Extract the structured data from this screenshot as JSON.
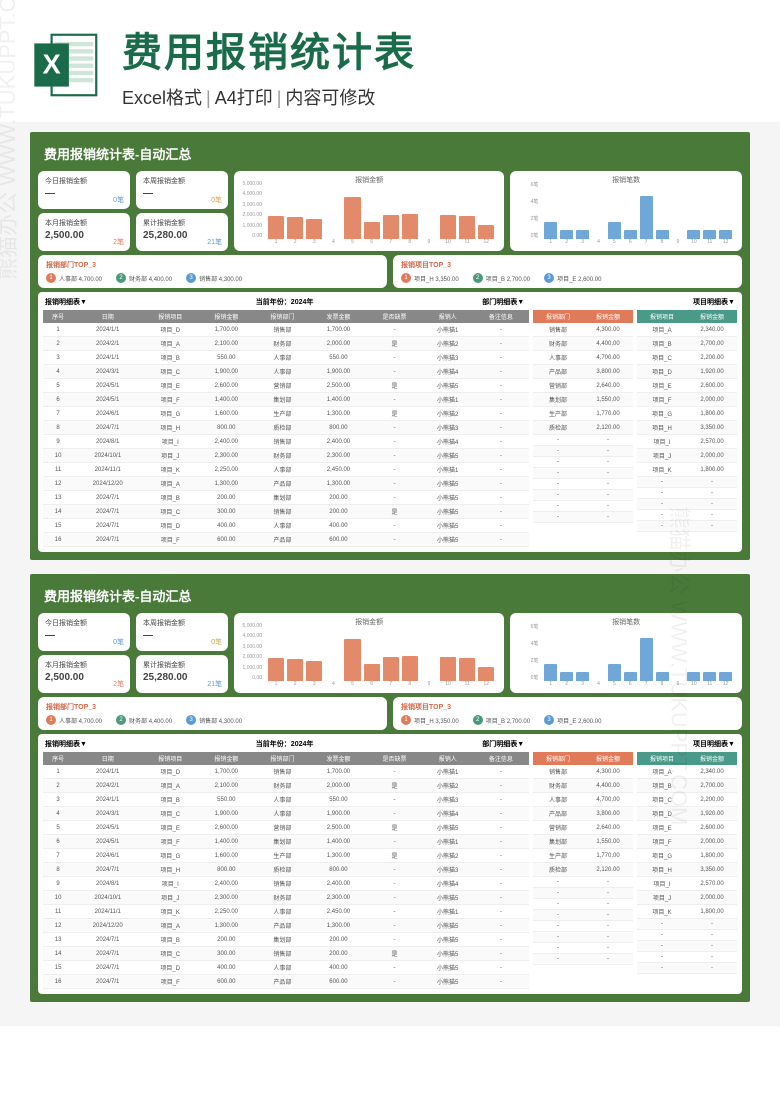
{
  "header": {
    "title": "费用报销统计表",
    "subtitle_parts": [
      "Excel格式",
      "A4打印",
      "内容可修改"
    ]
  },
  "watermark_text": "熊猫办公 WWW.TUKUPPT.COM",
  "sheet": {
    "title": "费用报销统计表-自动汇总",
    "stats": {
      "today": {
        "label": "今日报销金额",
        "value": "—",
        "count": "0笔"
      },
      "week": {
        "label": "本周报销金额",
        "value": "—",
        "count": "0笔"
      },
      "month": {
        "label": "本月报销金额",
        "value": "2,500.00",
        "count": "2笔"
      },
      "total": {
        "label": "累计报销金额",
        "value": "25,280.00",
        "count": "21笔"
      }
    },
    "top_dept": {
      "title": "报销部门TOP_3",
      "items": [
        {
          "rank": "1",
          "name": "人事部",
          "value": "4,700.00"
        },
        {
          "rank": "2",
          "name": "财务部",
          "value": "4,400.00"
        },
        {
          "rank": "3",
          "name": "销售部",
          "value": "4,300.00"
        }
      ]
    },
    "top_project": {
      "title": "报销项目TOP_3",
      "items": [
        {
          "rank": "1",
          "name": "项目_H",
          "value": "3,350.00"
        },
        {
          "rank": "2",
          "name": "项目_B",
          "value": "2,700.00"
        },
        {
          "rank": "3",
          "name": "项目_E",
          "value": "2,600.00"
        }
      ]
    },
    "data_labels": {
      "detail_title": "报销明细表▼",
      "period_label": "当前年份：",
      "period_value": "2024年",
      "dept_title": "部门明细表▼",
      "proj_title": "项目明细表▼"
    },
    "main_headers": [
      "序号",
      "日期",
      "报销项目",
      "报销金额",
      "报销部门",
      "发票金额",
      "是否缺票",
      "报销人",
      "备注信息"
    ],
    "main_rows": [
      [
        "1",
        "2024/1/1",
        "项目_D",
        "1,700.00",
        "销售部",
        "1,700.00",
        "",
        "小熊猫1",
        ""
      ],
      [
        "2",
        "2024/2/1",
        "项目_A",
        "2,100.00",
        "财务部",
        "2,000.00",
        "是",
        "小熊猫2",
        ""
      ],
      [
        "3",
        "2024/1/1",
        "项目_B",
        "550.00",
        "人事部",
        "550.00",
        "",
        "小熊猫3",
        ""
      ],
      [
        "4",
        "2024/3/1",
        "项目_C",
        "1,900.00",
        "人事部",
        "1,900.00",
        "",
        "小熊猫4",
        ""
      ],
      [
        "5",
        "2024/5/1",
        "项目_E",
        "2,600.00",
        "营销部",
        "2,500.00",
        "是",
        "小熊猫5",
        ""
      ],
      [
        "6",
        "2024/5/1",
        "项目_F",
        "1,400.00",
        "集划部",
        "1,400.00",
        "",
        "小熊猫1",
        ""
      ],
      [
        "7",
        "2024/6/1",
        "项目_G",
        "1,600.00",
        "生产部",
        "1,300.00",
        "是",
        "小熊猫2",
        ""
      ],
      [
        "8",
        "2024/7/1",
        "项目_H",
        "800.00",
        "质检部",
        "800.00",
        "",
        "小熊猫3",
        ""
      ],
      [
        "9",
        "2024/8/1",
        "项目_I",
        "2,400.00",
        "销售部",
        "2,400.00",
        "",
        "小熊猫4",
        ""
      ],
      [
        "10",
        "2024/10/1",
        "项目_J",
        "2,300.00",
        "财务部",
        "2,300.00",
        "",
        "小熊猫5",
        ""
      ],
      [
        "11",
        "2024/11/1",
        "项目_K",
        "2,250.00",
        "人事部",
        "2,450.00",
        "",
        "小熊猫1",
        ""
      ],
      [
        "12",
        "2024/12/20",
        "项目_A",
        "1,300.00",
        "产品部",
        "1,300.00",
        "",
        "小熊猫5",
        ""
      ],
      [
        "13",
        "2024/7/1",
        "项目_B",
        "200.00",
        "集划部",
        "200.00",
        "",
        "小熊猫5",
        ""
      ],
      [
        "14",
        "2024/7/1",
        "项目_C",
        "300.00",
        "销售部",
        "200.00",
        "是",
        "小熊猫5",
        ""
      ],
      [
        "15",
        "2024/7/1",
        "项目_D",
        "400.00",
        "人事部",
        "400.00",
        "",
        "小熊猫5",
        ""
      ],
      [
        "16",
        "2024/7/1",
        "项目_F",
        "600.00",
        "产品部",
        "600.00",
        "",
        "小熊猫5",
        ""
      ]
    ],
    "dept_headers": [
      "报销部门",
      "报销金额"
    ],
    "dept_rows": [
      [
        "销售部",
        "4,300.00"
      ],
      [
        "财务部",
        "4,400.00"
      ],
      [
        "人事部",
        "4,700.00"
      ],
      [
        "产品部",
        "3,800.00"
      ],
      [
        "营销部",
        "2,640.00"
      ],
      [
        "集划部",
        "1,550.00"
      ],
      [
        "生产部",
        "1,770.00"
      ],
      [
        "质检部",
        "2,120.00"
      ],
      [
        "",
        ""
      ],
      [
        "",
        ""
      ],
      [
        "",
        ""
      ],
      [
        "",
        ""
      ],
      [
        "",
        ""
      ],
      [
        "",
        ""
      ],
      [
        "",
        ""
      ],
      [
        "",
        ""
      ]
    ],
    "proj_headers": [
      "报销项目",
      "报销金额"
    ],
    "proj_rows": [
      [
        "项目_A",
        "2,340.00"
      ],
      [
        "项目_B",
        "2,700.00"
      ],
      [
        "项目_C",
        "2,200.00"
      ],
      [
        "项目_D",
        "1,920.00"
      ],
      [
        "项目_E",
        "2,600.00"
      ],
      [
        "项目_F",
        "2,000.00"
      ],
      [
        "项目_G",
        "1,800.00"
      ],
      [
        "项目_H",
        "3,350.00"
      ],
      [
        "项目_I",
        "2,570.00"
      ],
      [
        "项目_J",
        "2,000.00"
      ],
      [
        "项目_K",
        "1,800.00"
      ],
      [
        "",
        ""
      ],
      [
        "",
        ""
      ],
      [
        "",
        ""
      ],
      [
        "",
        ""
      ],
      [
        "",
        ""
      ]
    ]
  },
  "chart_data": [
    {
      "type": "bar",
      "title": "报销金额",
      "categories": [
        "1",
        "2",
        "3",
        "4",
        "5",
        "6",
        "7",
        "8",
        "9",
        "10",
        "11",
        "12"
      ],
      "values": [
        2250,
        2100,
        1900,
        0,
        4000,
        1600,
        2300,
        2400,
        0,
        2300,
        2250,
        1300
      ],
      "ylim": [
        0,
        5000
      ],
      "yticks": [
        "5,000.00",
        "4,000.00",
        "3,000.00",
        "2,000.00",
        "1,000.00",
        "0.00"
      ],
      "color": "#e28a6a"
    },
    {
      "type": "bar",
      "title": "报销笔数",
      "categories": [
        "1",
        "2",
        "3",
        "4",
        "5",
        "6",
        "7",
        "8",
        "9",
        "10",
        "11",
        "12"
      ],
      "values": [
        2,
        1,
        1,
        0,
        2,
        1,
        5,
        1,
        0,
        1,
        1,
        1
      ],
      "ylim": [
        0,
        6
      ],
      "yticks": [
        "6笔",
        "4笔",
        "2笔",
        "0笔"
      ],
      "color": "#6fa8d8"
    }
  ]
}
